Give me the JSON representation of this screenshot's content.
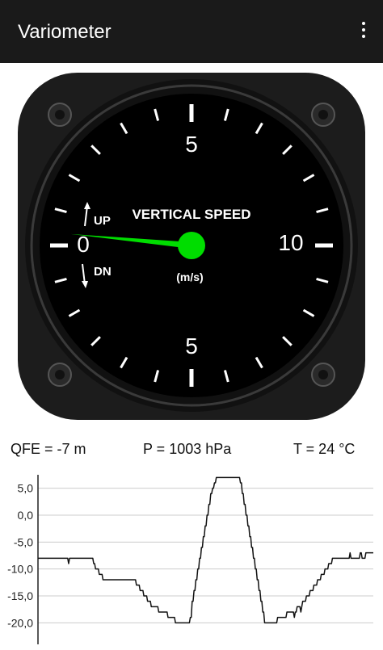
{
  "app": {
    "title": "Variometer",
    "menu_icon": "more-vert-icon"
  },
  "gauge": {
    "title": "VERTICAL SPEED",
    "unit": "(m/s)",
    "up_label": "UP",
    "down_label": "DN",
    "scale_labels": {
      "zero": "0",
      "top": "5",
      "right": "10",
      "bottom": "5"
    },
    "needle_value": 0.3,
    "needle_color": "#00dd00",
    "bezel_color": "#1c1c1c"
  },
  "readings": {
    "qfe": "QFE = -7 m",
    "pressure": "P = 1003 hPa",
    "temperature": "T = 24 °C"
  },
  "chart_data": {
    "type": "line",
    "title": "",
    "xlabel": "",
    "ylabel": "",
    "ylim": [
      -21,
      7.5
    ],
    "yticks": [
      "5,0",
      "0,0",
      "-5,0",
      "-10,0",
      "-15,0",
      "-20,0"
    ],
    "grid": true,
    "series": [
      {
        "values": [
          -8,
          -8,
          -8,
          -8,
          -8,
          -8,
          -8,
          -8,
          -8,
          -8,
          -8,
          -8,
          -8,
          -8,
          -8,
          -8,
          -8,
          -8,
          -8,
          -8,
          -8,
          -8,
          -8,
          -8,
          -8,
          -8,
          -8,
          -8,
          -8,
          -8,
          -8,
          -8,
          -8,
          -9,
          -8,
          -8,
          -8,
          -8,
          -8,
          -8,
          -8,
          -8,
          -8,
          -8,
          -8,
          -8,
          -8,
          -8,
          -8,
          -8,
          -8,
          -8,
          -8,
          -8,
          -8,
          -8,
          -8,
          -8,
          -8,
          -8,
          -9,
          -9,
          -10,
          -10,
          -10,
          -10,
          -11,
          -11,
          -11,
          -11,
          -12,
          -12,
          -12,
          -12,
          -12,
          -12,
          -12,
          -12,
          -12,
          -12,
          -12,
          -12,
          -12,
          -12,
          -12,
          -12,
          -12,
          -12,
          -12,
          -12,
          -12,
          -12,
          -12,
          -12,
          -12,
          -12,
          -12,
          -12,
          -12,
          -12,
          -12,
          -12,
          -12,
          -12,
          -12,
          -12,
          -13,
          -13,
          -13,
          -13,
          -14,
          -14,
          -14,
          -14,
          -15,
          -15,
          -15,
          -15,
          -16,
          -16,
          -16,
          -16,
          -17,
          -17,
          -17,
          -17,
          -17,
          -17,
          -17,
          -17,
          -18,
          -18,
          -18,
          -18,
          -18,
          -18,
          -18,
          -18,
          -18,
          -18,
          -19,
          -19,
          -19,
          -19,
          -19,
          -19,
          -19,
          -19,
          -20,
          -20,
          -20,
          -20,
          -20,
          -20,
          -20,
          -20,
          -20,
          -20,
          -20,
          -20,
          -20,
          -20,
          -20,
          -20,
          -19,
          -19,
          -16,
          -16,
          -14,
          -14,
          -12,
          -12,
          -10,
          -10,
          -8,
          -8,
          -6,
          -6,
          -4,
          -4,
          -2,
          -2,
          0,
          0,
          2,
          2,
          4,
          4,
          5,
          5,
          6,
          6,
          7,
          7,
          7,
          7,
          7,
          7,
          7,
          7,
          7,
          7,
          7,
          7,
          7,
          7,
          7,
          7,
          7,
          7,
          7,
          7,
          7,
          7,
          7,
          7,
          7,
          7,
          6,
          6,
          4,
          4,
          2,
          2,
          0,
          0,
          -2,
          -2,
          -4,
          -4,
          -6,
          -6,
          -8,
          -8,
          -10,
          -10,
          -12,
          -12,
          -14,
          -14,
          -16,
          -16,
          -18,
          -18,
          -20,
          -20,
          -20,
          -20,
          -20,
          -20,
          -20,
          -20,
          -20,
          -20,
          -20,
          -20,
          -20,
          -20,
          -19,
          -19,
          -19,
          -19,
          -19,
          -19,
          -19,
          -19,
          -19,
          -19,
          -18,
          -18,
          -18,
          -18,
          -18,
          -18,
          -18,
          -18,
          -19,
          -18,
          -18,
          -17,
          -17,
          -17,
          -17,
          -18,
          -17,
          -16,
          -16,
          -16,
          -16,
          -15,
          -15,
          -15,
          -15,
          -14,
          -14,
          -14,
          -14,
          -13,
          -13,
          -13,
          -13,
          -12,
          -12,
          -12,
          -12,
          -11,
          -11,
          -11,
          -11,
          -10,
          -10,
          -10,
          -10,
          -9,
          -9,
          -9,
          -9,
          -8,
          -8,
          -8,
          -8,
          -8,
          -8,
          -8,
          -8,
          -8,
          -8,
          -8,
          -8,
          -8,
          -8,
          -8,
          -8,
          -8,
          -8,
          -8,
          -7,
          -8,
          -8,
          -8,
          -8,
          -8,
          -8,
          -8,
          -8,
          -8,
          -8,
          -7,
          -7,
          -8,
          -8,
          -8,
          -8,
          -7,
          -7,
          -7,
          -7,
          -7,
          -7,
          -7,
          -7,
          -7
        ]
      }
    ]
  }
}
